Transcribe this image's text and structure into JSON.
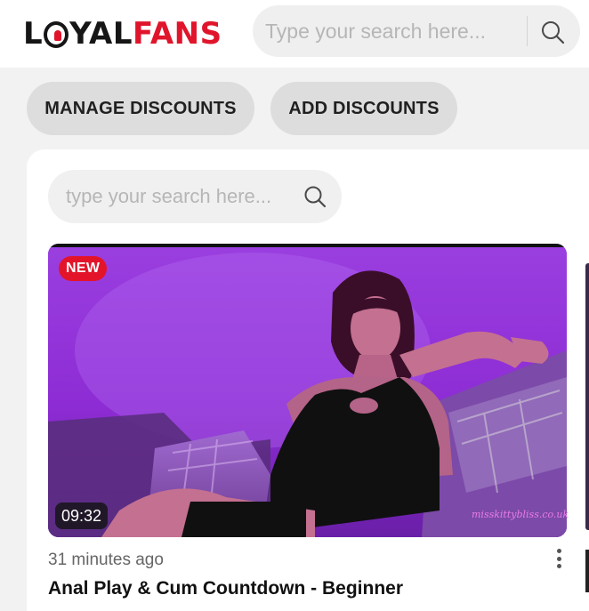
{
  "header": {
    "logo_part1": "L",
    "logo_part2": "YAL",
    "logo_part3": "FANS",
    "search_placeholder": "Type your search here..."
  },
  "actions": {
    "manage_label": "MANAGE DISCOUNTS",
    "add_label": "ADD DISCOUNTS"
  },
  "content": {
    "search_placeholder": "type your search here..."
  },
  "video": {
    "badge": "NEW",
    "duration": "09:32",
    "watermark": "misskittybliss.co.uk",
    "posted": "31 minutes ago",
    "title": "Anal Play & Cum Countdown - Beginner"
  },
  "colors": {
    "brand_red": "#e0152b",
    "brand_dark": "#161616",
    "thumbnail_purple": "#8f2bd0"
  },
  "icons": [
    "search-icon",
    "more-vertical-icon"
  ]
}
